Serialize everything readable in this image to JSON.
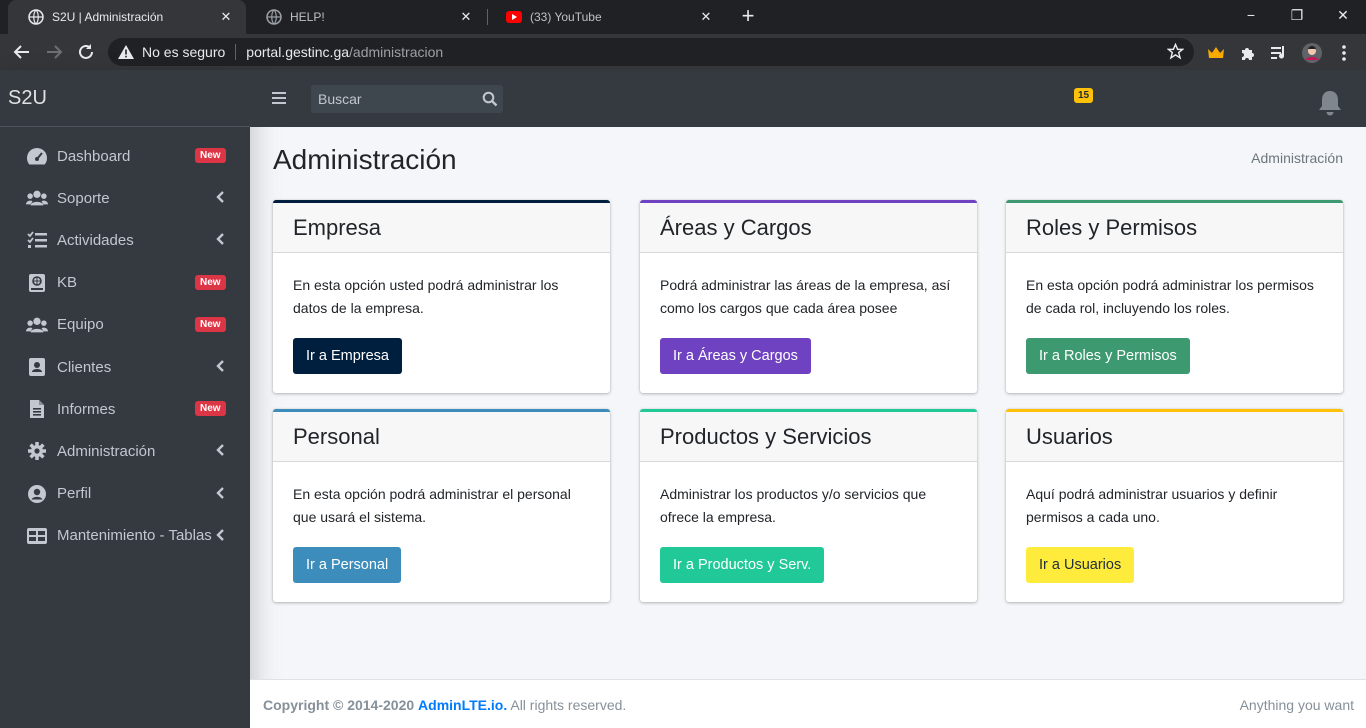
{
  "browser": {
    "tabs": [
      {
        "title": "S2U | Administración",
        "active": true,
        "icon": "globe-icon"
      },
      {
        "title": "HELP!",
        "active": false,
        "icon": "globe-icon"
      },
      {
        "title": "(33) YouTube",
        "active": false,
        "icon": "youtube-icon"
      }
    ],
    "new_tab": "+",
    "window_controls": {
      "minimize": "−",
      "restore": "❐",
      "close": "✕"
    },
    "security_label": "No es seguro",
    "url_host": "portal.gestinc.ga",
    "url_path": "/administracion"
  },
  "sidebar": {
    "brand": "S2U",
    "items": [
      {
        "label": "Dashboard",
        "icon": "dashboard-icon",
        "badge": "New",
        "chevron": false
      },
      {
        "label": "Soporte",
        "icon": "users-icon",
        "badge": "",
        "chevron": true
      },
      {
        "label": "Actividades",
        "icon": "tasks-icon",
        "badge": "",
        "chevron": true
      },
      {
        "label": "KB",
        "icon": "book-icon",
        "badge": "New",
        "chevron": false
      },
      {
        "label": "Equipo",
        "icon": "team-icon",
        "badge": "New",
        "chevron": false
      },
      {
        "label": "Clientes",
        "icon": "address-book-icon",
        "badge": "",
        "chevron": true
      },
      {
        "label": "Informes",
        "icon": "file-icon",
        "badge": "New",
        "chevron": false
      },
      {
        "label": "Administración",
        "icon": "gear-icon",
        "badge": "",
        "chevron": true
      },
      {
        "label": "Perfil",
        "icon": "user-circle-icon",
        "badge": "",
        "chevron": true
      },
      {
        "label": "Mantenimiento - Tablas",
        "icon": "table-icon",
        "badge": "",
        "chevron": true
      }
    ]
  },
  "topbar": {
    "search_placeholder": "Buscar",
    "notifications_count": "15"
  },
  "page": {
    "title": "Administración",
    "breadcrumb": "Administración"
  },
  "cards": [
    {
      "title": "Empresa",
      "text": "En esta opción usted podrá administrar los datos de la empresa.",
      "button": "Ir a Empresa",
      "color": "#001f3f",
      "text_color": "#ffffff"
    },
    {
      "title": "Áreas y Cargos",
      "text": "Podrá administrar las áreas de la empresa, así como los cargos que cada área posee",
      "button": "Ir a Áreas y Cargos",
      "color": "#6f42c1",
      "text_color": "#ffffff"
    },
    {
      "title": "Roles y Permisos",
      "text": "En esta opción podrá administrar los permisos de cada rol, incluyendo los roles.",
      "button": "Ir a Roles y Permisos",
      "color": "#3d9970",
      "text_color": "#ffffff"
    },
    {
      "title": "Personal",
      "text": "En esta opción podrá administrar el personal que usará el sistema.",
      "button": "Ir a Personal",
      "color": "#3c8dbc",
      "text_color": "#ffffff"
    },
    {
      "title": "Productos y Servicios",
      "text": "Administrar los productos y/o servicios que ofrece la empresa.",
      "button": "Ir a Productos y Serv.",
      "color": "#20c997",
      "text_color": "#ffffff"
    },
    {
      "title": "Usuarios",
      "text": "Aquí podrá administrar usuarios y definir permisos a cada uno.",
      "button": "Ir a Usuarios",
      "color": "#ffeb3b",
      "text_color": "#1f2d3d",
      "border_color": "#ffc107"
    }
  ],
  "footer": {
    "copyright_prefix": "Copyright © 2014-2020",
    "link": "AdminLTE.io.",
    "suffix": "All rights reserved.",
    "right": "Anything you want"
  }
}
